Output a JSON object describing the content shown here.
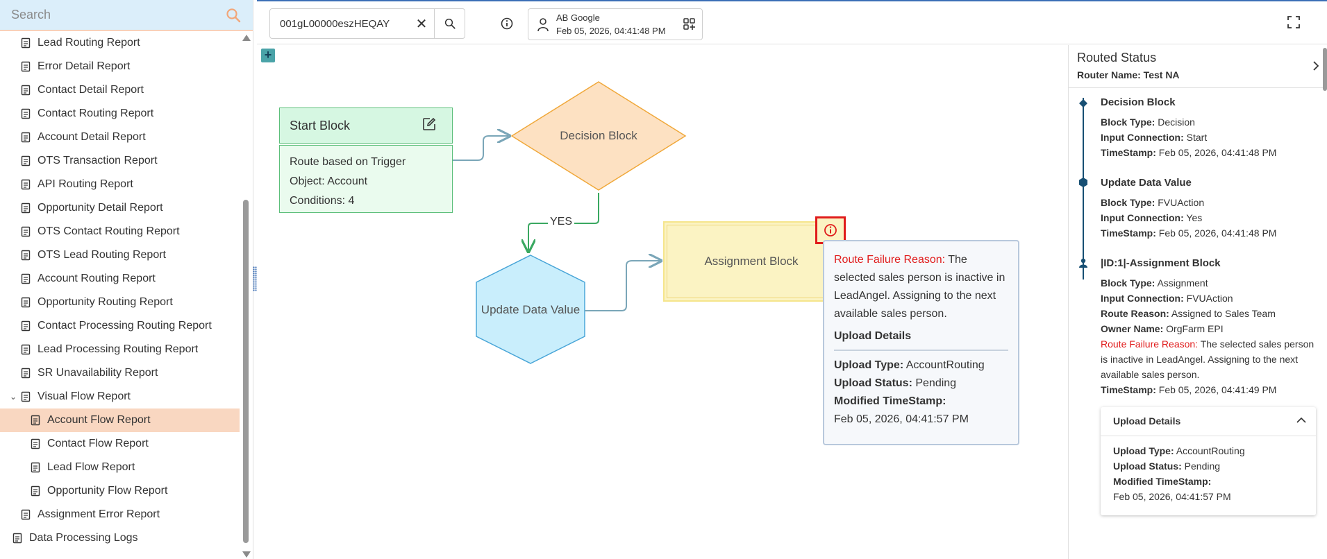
{
  "search": {
    "placeholder": "Search"
  },
  "sidebar": {
    "items": [
      {
        "label": "Lead Routing Report",
        "level": 1,
        "icon": "lead-report-icon"
      },
      {
        "label": "Error Detail Report",
        "level": 1,
        "icon": "error-report-icon"
      },
      {
        "label": "Contact Detail Report",
        "level": 1,
        "icon": "contact-report-icon"
      },
      {
        "label": "Contact Routing Report",
        "level": 1,
        "icon": "bar-chart-icon"
      },
      {
        "label": "Account Detail Report",
        "level": 1,
        "icon": "account-report-icon"
      },
      {
        "label": "OTS Transaction Report",
        "level": 1,
        "icon": "transaction-icon"
      },
      {
        "label": "API Routing Report",
        "level": 1,
        "icon": "api-icon"
      },
      {
        "label": "Opportunity Detail Report",
        "level": 1,
        "icon": "opportunity-icon"
      },
      {
        "label": "OTS Contact Routing Report",
        "level": 1,
        "icon": "ots-contact-icon"
      },
      {
        "label": "OTS Lead Routing Report",
        "level": 1,
        "icon": "ots-lead-icon"
      },
      {
        "label": "Account Routing Report",
        "level": 1,
        "icon": "account-routing-icon"
      },
      {
        "label": "Opportunity Routing Report",
        "level": 1,
        "icon": "opportunity-routing-icon"
      },
      {
        "label": "Contact Processing Routing Report",
        "level": 1,
        "icon": "contact-processing-icon"
      },
      {
        "label": "Lead Processing Routing Report",
        "level": 1,
        "icon": "lead-processing-icon"
      },
      {
        "label": "SR Unavailability Report",
        "level": 1,
        "icon": "unavailability-icon"
      },
      {
        "label": "Visual Flow Report",
        "level": 1,
        "icon": "visual-flow-icon",
        "expanded": true
      },
      {
        "label": "Account Flow Report",
        "level": 2,
        "icon": "account-flow-icon",
        "active": true
      },
      {
        "label": "Contact Flow Report",
        "level": 2,
        "icon": "bar-chart-icon"
      },
      {
        "label": "Lead Flow Report",
        "level": 2,
        "icon": "lead-flow-icon"
      },
      {
        "label": "Opportunity Flow Report",
        "level": 2,
        "icon": "opportunity-flow-icon"
      },
      {
        "label": "Assignment Error Report",
        "level": 1,
        "icon": "assignment-error-icon"
      },
      {
        "label": "Data Processing Logs",
        "level": 0,
        "icon": "data-logs-icon"
      }
    ]
  },
  "topbar": {
    "record_id": "001gL00000eszHEQAY",
    "account_name": "AB Google",
    "account_timestamp": "Feb 05, 2026, 04:41:48 PM"
  },
  "flow": {
    "start_block": {
      "title": "Start Block",
      "lines": [
        "Route based on Trigger",
        "Object: Account",
        "Conditions: 4"
      ]
    },
    "decision_block": "Decision Block",
    "yes_label": "YES",
    "update_block": "Update Data Value",
    "assignment_block": "Assignment Block",
    "popup": {
      "failure_label": "Route Failure Reason:",
      "failure_text": "The selected sales person is inactive in LeadAngel. Assigning to the next available sales person.",
      "upload_title": "Upload Details",
      "upload_type_label": "Upload Type:",
      "upload_type": "AccountRouting",
      "upload_status_label": "Upload Status:",
      "upload_status": "Pending",
      "modified_label": "Modified TimeStamp:",
      "modified": "Feb 05, 2026, 04:41:57 PM"
    }
  },
  "routed_status": {
    "title": "Routed Status",
    "router_name": "Router Name: Test NA",
    "steps": [
      {
        "title": "Decision Block",
        "fields": [
          {
            "label": "Block Type:",
            "value": "Decision"
          },
          {
            "label": "Input Connection:",
            "value": "Start"
          },
          {
            "label": "TimeStamp:",
            "value": "Feb 05, 2026, 04:41:48 PM"
          }
        ]
      },
      {
        "title": "Update Data Value",
        "fields": [
          {
            "label": "Block Type:",
            "value": "FVUAction"
          },
          {
            "label": "Input Connection:",
            "value": "Yes"
          },
          {
            "label": "TimeStamp:",
            "value": "Feb 05, 2026, 04:41:48 PM"
          }
        ]
      },
      {
        "title": "|ID:1|-Assignment Block",
        "fields": [
          {
            "label": "Block Type:",
            "value": "Assignment"
          },
          {
            "label": "Input Connection:",
            "value": "FVUAction"
          },
          {
            "label": "Route Reason:",
            "value": "Assigned to Sales Team"
          },
          {
            "label": "Owner Name:",
            "value": "OrgFarm EPI"
          },
          {
            "label": "Route Failure Reason:",
            "value": "The selected sales person is inactive in LeadAngel. Assigning to the next available sales person.",
            "highlight": true
          },
          {
            "label": "TimeStamp:",
            "value": "Feb 05, 2026, 04:41:49 PM"
          }
        ]
      }
    ],
    "upload_details": {
      "title": "Upload Details",
      "upload_type_label": "Upload Type:",
      "upload_type": "AccountRouting",
      "upload_status_label": "Upload Status:",
      "upload_status": "Pending",
      "modified_label": "Modified TimeStamp:",
      "modified": "Feb 05, 2026, 04:41:57 PM"
    }
  },
  "colors": {
    "accent_orange": "#f2a679",
    "active_item": "#f9d7c1",
    "error_red": "#e01b1b",
    "timeline_blue": "#174f73"
  }
}
